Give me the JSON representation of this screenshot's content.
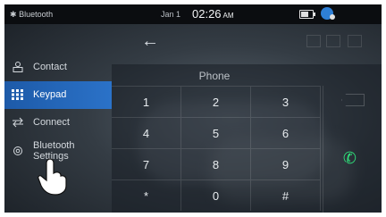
{
  "status": {
    "bluetooth_label": "Bluetooth",
    "date": "Jan 1",
    "time": "02:26",
    "ampm": "AM"
  },
  "sidebar": {
    "items": [
      {
        "label": "Contact",
        "icon": "contact-icon",
        "active": false
      },
      {
        "label": "Keypad",
        "icon": "keypad-icon",
        "active": true
      },
      {
        "label": "Connect",
        "icon": "connect-icon",
        "active": false
      },
      {
        "label": "Bluetooth Settings",
        "icon": "settings-icon",
        "active": false
      }
    ]
  },
  "dialpad": {
    "title": "Phone",
    "keys": [
      "1",
      "2",
      "3",
      "4",
      "5",
      "6",
      "7",
      "8",
      "9",
      "*",
      "0",
      "#"
    ]
  },
  "colors": {
    "active_blue": "#2b72c8",
    "call_green": "#2fe07a"
  }
}
